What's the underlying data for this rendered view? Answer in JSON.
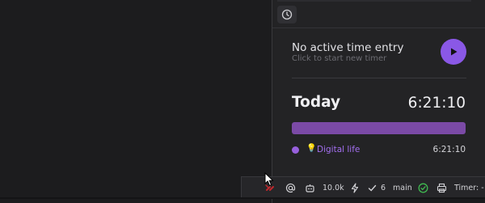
{
  "timer_panel": {
    "no_entry_title": "No active time entry",
    "no_entry_subtitle": "Click to start new timer",
    "today_label": "Today",
    "today_total": "6:21:10",
    "progress_fraction": 1.0,
    "project": {
      "name": "Digital life",
      "emoji": "💡",
      "duration": "6:21:10",
      "color": "#9760dd"
    }
  },
  "status_bar": {
    "count_label": "10.0k",
    "check_count": "6",
    "branch": "main",
    "timer_label": "Timer: -"
  },
  "colors": {
    "accent": "#8a58e6",
    "bar": "#7b4aa6",
    "ok": "#3fb950"
  }
}
